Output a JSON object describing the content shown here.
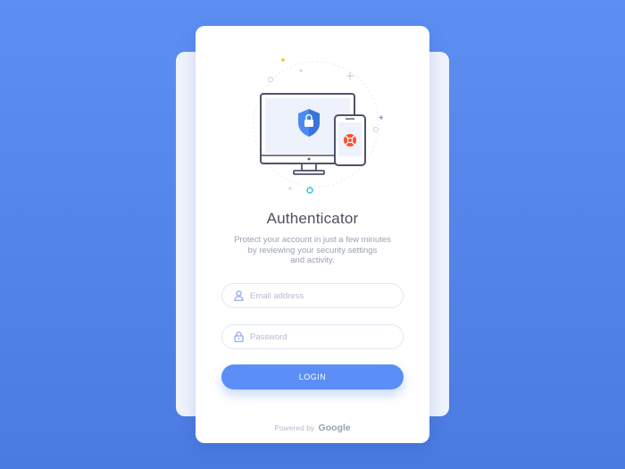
{
  "card": {
    "title": "Authenticator",
    "description_lines": [
      "Protect your account in just a few minutes",
      "by reviewing your security settings",
      "and activity."
    ]
  },
  "form": {
    "email_placeholder": "Email address",
    "password_placeholder": "Password",
    "login_label": "LOGIN"
  },
  "footer": {
    "powered_prefix": "Powered by",
    "brand": "Google"
  },
  "icons": {
    "email": "user-icon",
    "password": "lock-icon",
    "hero": "secure-devices-icon"
  },
  "colors": {
    "background": "#5d8ff3",
    "accent": "#5b8ef6",
    "title": "#4d4f5c",
    "muted": "#9aa1b4",
    "danger": "#ff4f2d"
  }
}
